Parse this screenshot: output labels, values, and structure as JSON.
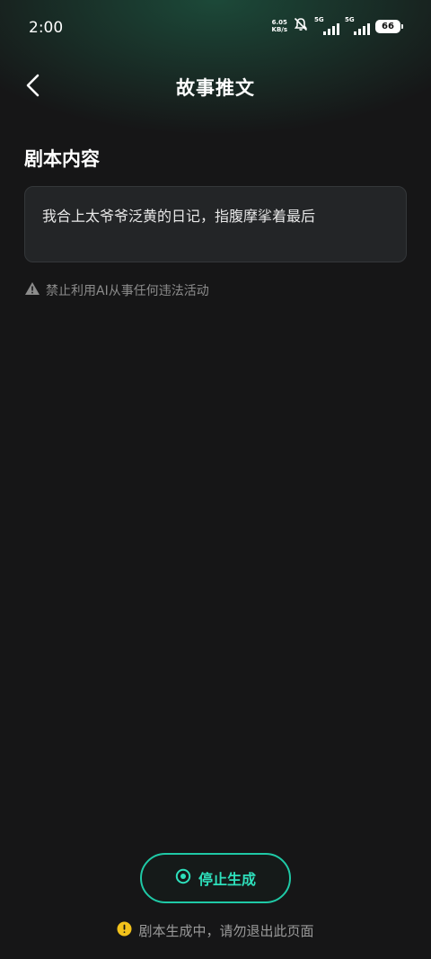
{
  "status_bar": {
    "time": "2:00",
    "net_speed_value": "6.05",
    "net_speed_unit": "KB/s",
    "sim1_label": "5G",
    "sim2_label": "5G",
    "battery_level": "66"
  },
  "header": {
    "title": "故事推文",
    "back_icon": "chevron-left-icon"
  },
  "script_section": {
    "title": "剧本内容",
    "content": "我合上太爷爷泛黄的日记，指腹摩挲着最后"
  },
  "notice": {
    "text": "禁止利用AI从事任何违法活动",
    "icon": "warning-icon"
  },
  "actions": {
    "stop_label": "停止生成",
    "stop_icon": "stop-circle-icon"
  },
  "footer": {
    "text": "剧本生成中，请勿退出此页面",
    "icon": "info-icon"
  },
  "colors": {
    "accent": "#1fc9a6",
    "background": "#161617",
    "warning_yellow": "#f2c21b"
  }
}
